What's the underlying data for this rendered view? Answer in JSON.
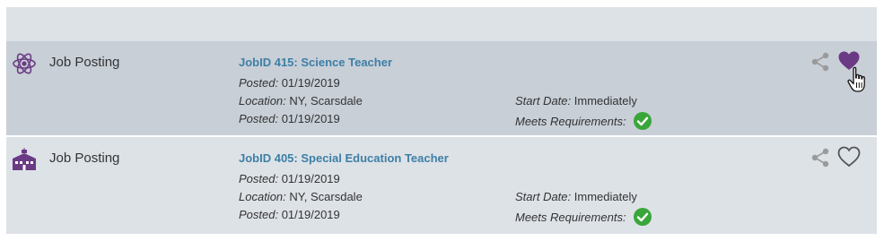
{
  "postings": [
    {
      "type_label": "Job Posting",
      "type_icon": "atom-icon",
      "title": "JobID 415:  Science Teacher",
      "posted_label": "Posted:",
      "posted_value": " 01/19/2019",
      "location_label": "Location:",
      "location_value": " NY, Scarsdale",
      "posted2_label": "Posted:",
      "posted2_value": " 01/19/2019",
      "start_label": "Start Date:",
      "start_value": " Immediately",
      "meets_label": "Meets Requirements:",
      "favorited": true
    },
    {
      "type_label": "Job Posting",
      "type_icon": "school-building-icon",
      "title": "JobID 405:  Special Education Teacher",
      "posted_label": "Posted:",
      "posted_value": " 01/19/2019",
      "location_label": "Location:",
      "location_value": " NY, Scarsdale",
      "posted2_label": "Posted:",
      "posted2_value": " 01/19/2019",
      "start_label": "Start Date:",
      "start_value": " Immediately",
      "meets_label": "Meets Requirements:",
      "favorited": false
    }
  ],
  "colors": {
    "brand_purple": "#6b3a84",
    "link_blue": "#3d7fa6",
    "check_green": "#3aa63a",
    "icon_gray": "#9a9a9a",
    "highlight_row": "#c8cfd7",
    "panel": "#dde2e7"
  }
}
